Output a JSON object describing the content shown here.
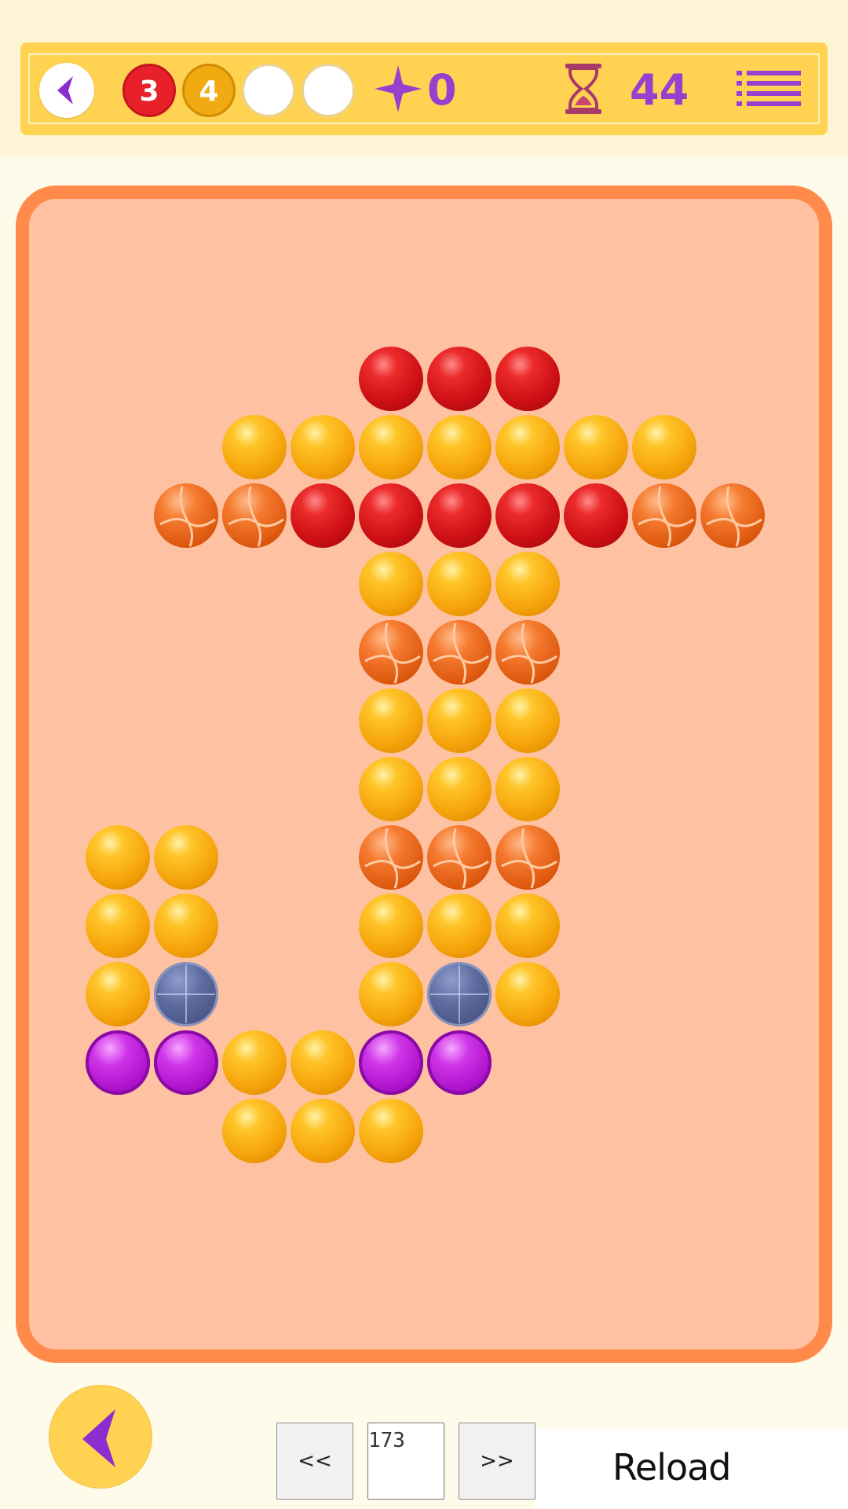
{
  "hud": {
    "badges": [
      "3",
      "4",
      "",
      ""
    ],
    "star_count": "0",
    "timer": "44"
  },
  "colors": {
    "accent": "#9640cf",
    "hud_bg": "#ffd252",
    "board_bg": "#fec2a2",
    "board_border": "#ff8a4a",
    "red_ball": "#e0161c",
    "gold_ball": "#f5a90e",
    "orange_ball": "#ef6a20",
    "magenta_ball": "#c120de",
    "steel_ball": "#4f5c8c"
  },
  "icons": {
    "hud_back": "chevron-left-icon",
    "star": "star-icon",
    "timer": "hourglass-icon",
    "menu": "menu-list-icon",
    "bottom_back": "chevron-left-icon"
  },
  "board": {
    "legend": {
      "R": "red",
      "G": "gold",
      "O": "orange-striped",
      "M": "magenta",
      "S": "steel-cross",
      ".": "empty"
    },
    "rows": [
      "....RRR....",
      "..GGGGGGG..",
      ".OORRRRROO.",
      "....GGG....",
      "....OOO....",
      "....GGG....",
      "....GGG....",
      "GG..OOO....",
      "GG..GGG....",
      "GS..GSG....",
      "MMGGMM.....",
      "..GGG......"
    ]
  },
  "footer": {
    "prev_label": "<<",
    "level": "173",
    "next_label": ">>",
    "reload_label": "Reload"
  }
}
